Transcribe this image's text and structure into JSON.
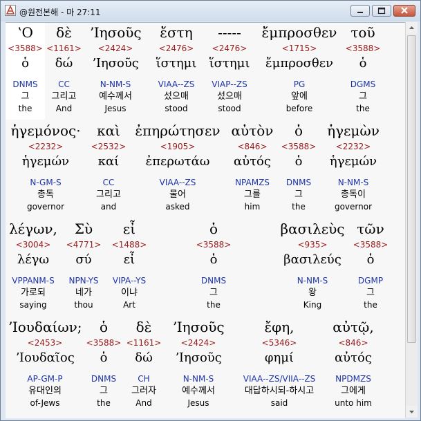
{
  "window": {
    "title": "@원전본해 - 마 27:11"
  },
  "lines": [
    {
      "words": [
        {
          "greek": "ʽΟ",
          "strong": "<3588>",
          "lemma": "ὁ",
          "morph": "DNMS",
          "korean": "그",
          "english": "the"
        },
        {
          "greek": "δὲ",
          "strong": "<1161>",
          "lemma": "δώ",
          "morph": "CC",
          "korean": "그리고",
          "english": "And"
        },
        {
          "greek": "ʼΙησοῦς",
          "strong": "<2424>",
          "lemma": "ʼΙησοῦς",
          "morph": "N-NM-S",
          "korean": "예수께서",
          "english": "Jesus"
        },
        {
          "greek": "ἔστη",
          "strong": "<2476>",
          "lemma": "ἵστημι",
          "morph": "VIAA--ZS",
          "korean": "섰으매",
          "english": "stood"
        },
        {
          "greek": "-----",
          "strong": "<2476>",
          "lemma": "ἵστημι",
          "morph": "VIAP--ZS",
          "korean": "섰으매",
          "english": "stood"
        },
        {
          "greek": "ἔμπροσθεν",
          "strong": "<1715>",
          "lemma": "ἔμπροσθεν",
          "morph": "PG",
          "korean": "앞에",
          "english": "before"
        },
        {
          "greek": "τοῦ",
          "strong": "<3588>",
          "lemma": "ὁ",
          "morph": "DGMS",
          "korean": "그",
          "english": "the"
        }
      ]
    },
    {
      "words": [
        {
          "greek": "ἡγεμόνος·",
          "strong": "<2232>",
          "lemma": "ἡγεμών",
          "morph": "N-GM-S",
          "korean": "총독",
          "english": "governor"
        },
        {
          "greek": "καὶ",
          "strong": "<2532>",
          "lemma": "καί",
          "morph": "CC",
          "korean": "그리고",
          "english": "and"
        },
        {
          "greek": "ἐπηρώτησεν",
          "strong": "<1905>",
          "lemma": "ἐπερωτάω",
          "morph": "VIAA--ZS",
          "korean": "물어",
          "english": "asked"
        },
        {
          "greek": "αὐτὸν",
          "strong": "<846>",
          "lemma": "αὐτός",
          "morph": "NPAMZS",
          "korean": "그를",
          "english": "him"
        },
        {
          "greek": "ὁ",
          "strong": "<3588>",
          "lemma": "ὁ",
          "morph": "DNMS",
          "korean": "그",
          "english": "the"
        },
        {
          "greek": "ἡγεμὼν",
          "strong": "<2232>",
          "lemma": "ἡγεμών",
          "morph": "N-NM-S",
          "korean": "총독이",
          "english": "governor"
        }
      ]
    },
    {
      "words": [
        {
          "greek": "λέγων,",
          "strong": "<3004>",
          "lemma": "λέγω",
          "morph": "VPPANM-S",
          "korean": "가로되",
          "english": "saying"
        },
        {
          "greek": "Σὺ",
          "strong": "<4771>",
          "lemma": "σύ",
          "morph": "NPN-YS",
          "korean": "네가",
          "english": "thou"
        },
        {
          "greek": "εἶ",
          "strong": "<1488>",
          "lemma": "εἶ",
          "morph": "VIPA--YS",
          "korean": "이냐",
          "english": "Art"
        },
        {
          "greek": "ὁ",
          "strong": "<3588>",
          "lemma": "ὁ",
          "morph": "DNMS",
          "korean": "그",
          "english": "the"
        },
        {
          "greek": "βασιλεὺς",
          "strong": "<935>",
          "lemma": "βασιλεύς",
          "morph": "N-NM-S",
          "korean": "왕",
          "english": "King"
        },
        {
          "greek": "τῶν",
          "strong": "<3588>",
          "lemma": "ὁ",
          "morph": "DGMP",
          "korean": "그",
          "english": "the"
        }
      ]
    },
    {
      "words": [
        {
          "greek": "ʼΙουδαίων;",
          "strong": "<2453>",
          "lemma": "ʼΙουδαῖος",
          "morph": "AP-GM-P",
          "korean": "유대인의",
          "english": "of-Jews"
        },
        {
          "greek": "ὁ",
          "strong": "<3588>",
          "lemma": "ὁ",
          "morph": "DNMS",
          "korean": "그",
          "english": "the"
        },
        {
          "greek": "δὲ",
          "strong": "<1161>",
          "lemma": "δώ",
          "morph": "CH",
          "korean": "그러자",
          "english": "And"
        },
        {
          "greek": "ʼΙησοῦς",
          "strong": "<2424>",
          "lemma": "ʼΙησοῦς",
          "morph": "N-NM-S",
          "korean": "예수께서",
          "english": "Jesus"
        },
        {
          "greek": "ἔφη,",
          "strong": "<5346>",
          "lemma": "φημί",
          "morph": "VIAA--ZS/VIIA--ZS",
          "korean": "대답하시되-하시고",
          "english": "said"
        },
        {
          "greek": "αὐτῷ,",
          "strong": "<846>",
          "lemma": "αὐτός",
          "morph": "NPDMZS",
          "korean": "그에게",
          "english": "unto him"
        }
      ]
    }
  ]
}
